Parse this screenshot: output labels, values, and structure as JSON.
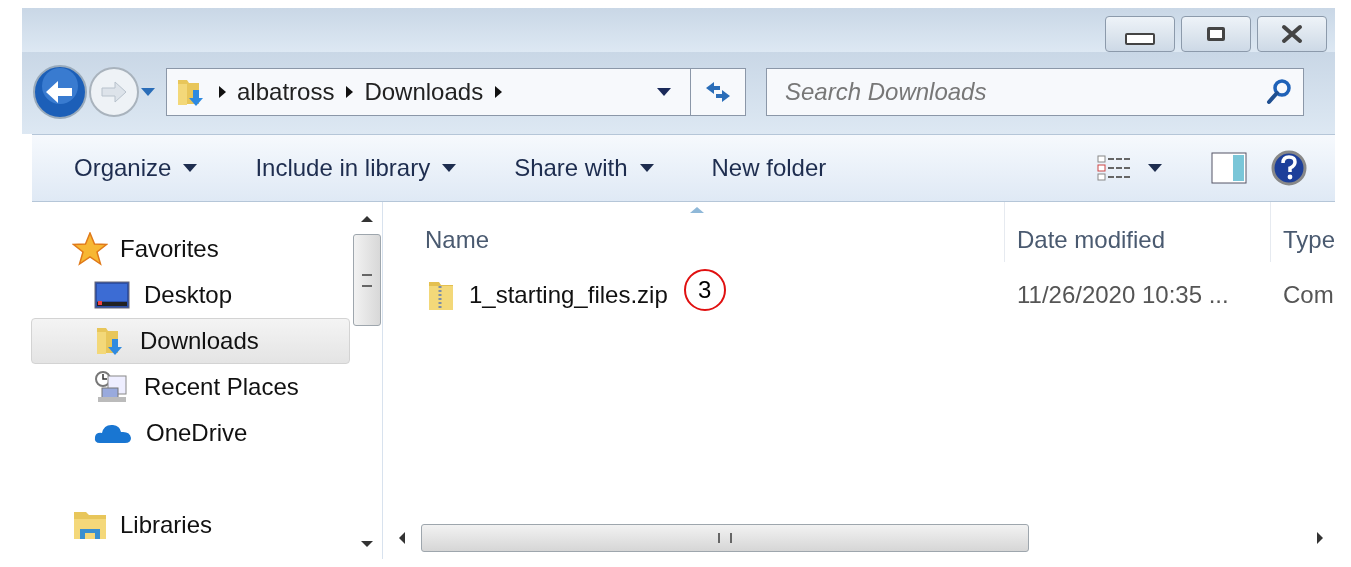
{
  "address": {
    "crumbs": [
      "albatross",
      "Downloads"
    ]
  },
  "search": {
    "placeholder": "Search Downloads"
  },
  "toolbar": [
    {
      "label": "Organize",
      "dropdown": true
    },
    {
      "label": "Include in library",
      "dropdown": true
    },
    {
      "label": "Share with",
      "dropdown": true
    },
    {
      "label": "New folder",
      "dropdown": false
    }
  ],
  "sidebar": {
    "groups": [
      {
        "label": "Favorites",
        "kind": "favorites",
        "children": [
          {
            "label": "Desktop",
            "kind": "desktop",
            "selected": false
          },
          {
            "label": "Downloads",
            "kind": "downloads",
            "selected": true
          },
          {
            "label": "Recent Places",
            "kind": "recent",
            "selected": false
          },
          {
            "label": "OneDrive",
            "kind": "onedrive",
            "selected": false
          }
        ]
      },
      {
        "label": "Libraries",
        "kind": "libraries"
      }
    ]
  },
  "table": {
    "columns": [
      {
        "label": "Name",
        "sorted": true
      },
      {
        "label": "Date modified",
        "sorted": false
      },
      {
        "label": "Type",
        "sorted": false
      }
    ],
    "rows": [
      {
        "name": "1_starting_files.zip",
        "date": "11/26/2020 10:35 ...",
        "type": "Com",
        "callout": "3"
      }
    ]
  }
}
